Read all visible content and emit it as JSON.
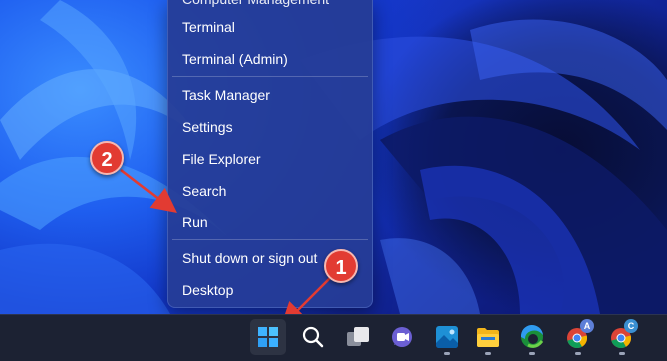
{
  "context_menu": {
    "items_partial_top": "Computer Management",
    "group1": [
      "Terminal",
      "Terminal (Admin)"
    ],
    "group2": [
      "Task Manager",
      "Settings",
      "File Explorer",
      "Search",
      "Run"
    ],
    "group3": [
      "Shut down or sign out",
      "Desktop"
    ]
  },
  "annotations": {
    "badge1": "1",
    "badge2": "2"
  },
  "taskbar": {
    "icons": [
      "windows-start-icon",
      "search-icon",
      "task-view-icon",
      "teams-chat-icon",
      "photos-icon",
      "file-explorer-icon",
      "edge-browser-icon",
      "chrome-profile-a-icon",
      "chrome-profile-c-icon"
    ],
    "chrome_a_label": "A",
    "chrome_c_label": "C"
  },
  "colors": {
    "annotation_red": "#e23b32",
    "menu_bg": "#263c96",
    "taskbar_bg": "#1c2233"
  }
}
